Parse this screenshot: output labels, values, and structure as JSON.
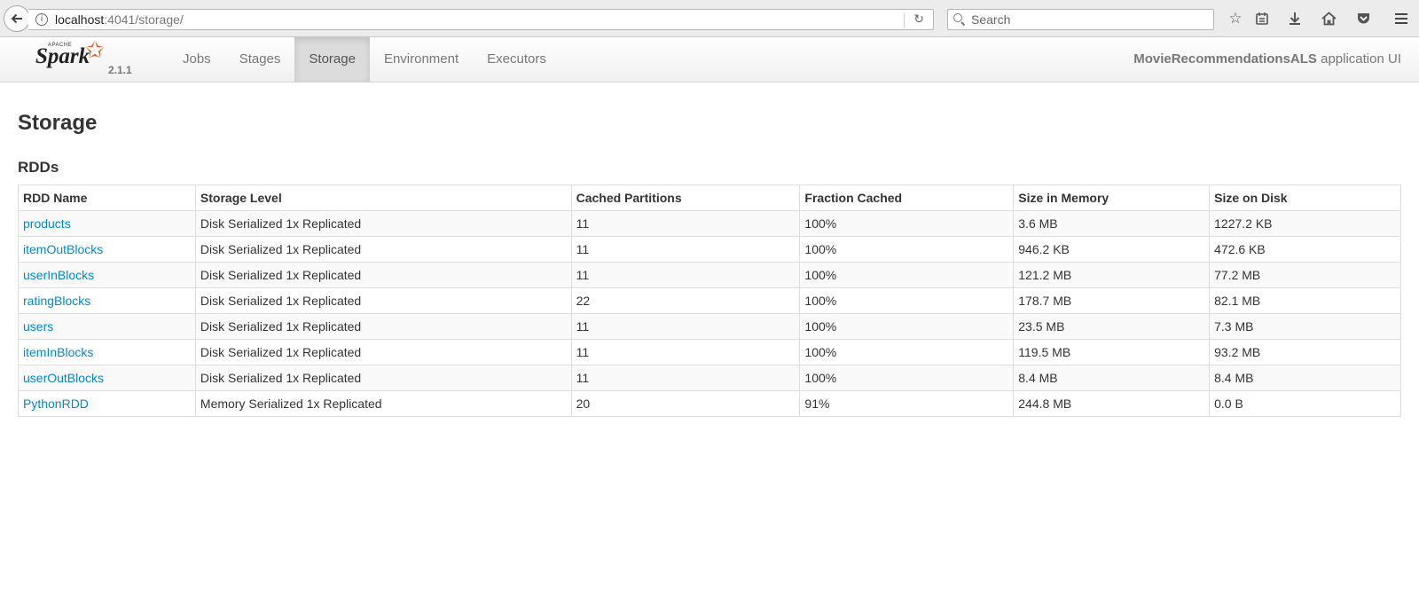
{
  "browser": {
    "url_host": "localhost",
    "url_rest": ":4041/storage/",
    "search_placeholder": "Search"
  },
  "navbar": {
    "logo_apache": "APACHE",
    "logo_spark": "Spark",
    "version": "2.1.1",
    "tabs": [
      {
        "label": "Jobs",
        "active": false
      },
      {
        "label": "Stages",
        "active": false
      },
      {
        "label": "Storage",
        "active": true
      },
      {
        "label": "Environment",
        "active": false
      },
      {
        "label": "Executors",
        "active": false
      }
    ],
    "app_name": "MovieRecommendationsALS",
    "app_suffix": "application UI"
  },
  "page": {
    "title": "Storage",
    "section": "RDDs"
  },
  "table": {
    "headers": [
      "RDD Name",
      "Storage Level",
      "Cached Partitions",
      "Fraction Cached",
      "Size in Memory",
      "Size on Disk"
    ],
    "rows": [
      [
        "products",
        "Disk Serialized 1x Replicated",
        "11",
        "100%",
        "3.6 MB",
        "1227.2 KB"
      ],
      [
        "itemOutBlocks",
        "Disk Serialized 1x Replicated",
        "11",
        "100%",
        "946.2 KB",
        "472.6 KB"
      ],
      [
        "userInBlocks",
        "Disk Serialized 1x Replicated",
        "11",
        "100%",
        "121.2 MB",
        "77.2 MB"
      ],
      [
        "ratingBlocks",
        "Disk Serialized 1x Replicated",
        "22",
        "100%",
        "178.7 MB",
        "82.1 MB"
      ],
      [
        "users",
        "Disk Serialized 1x Replicated",
        "11",
        "100%",
        "23.5 MB",
        "7.3 MB"
      ],
      [
        "itemInBlocks",
        "Disk Serialized 1x Replicated",
        "11",
        "100%",
        "119.5 MB",
        "93.2 MB"
      ],
      [
        "userOutBlocks",
        "Disk Serialized 1x Replicated",
        "11",
        "100%",
        "8.4 MB",
        "8.4 MB"
      ],
      [
        "PythonRDD",
        "Memory Serialized 1x Replicated",
        "20",
        "91%",
        "244.8 MB",
        "0.0 B"
      ]
    ]
  },
  "colors": {
    "link": "#0088cc",
    "spark_orange": "#e25a1c"
  }
}
